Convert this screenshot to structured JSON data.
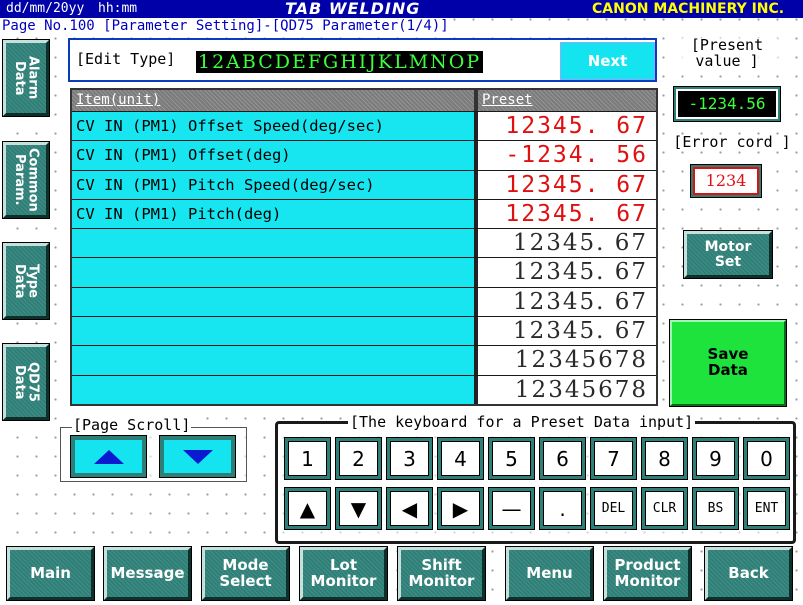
{
  "header": {
    "date": "dd/mm/20yy",
    "time": "hh:mm",
    "title": "TAB WELDING",
    "company": "CANON MACHINERY INC."
  },
  "page_line": "Page No.100 [Parameter Setting]-[QD75 Parameter(1/4)]",
  "side_tabs": [
    "Alarm Data",
    "Common Param.",
    "Type Data",
    "QD75 Data"
  ],
  "edit_type": {
    "label": "[Edit Type]",
    "value": "12ABCDEFGHIJKLMNOP",
    "next_label": "Next"
  },
  "table": {
    "headers": [
      "Item(unit)",
      "Preset"
    ],
    "rows": [
      {
        "item": "CV IN (PM1) Offset Speed(deg/sec)",
        "value": "12345. 67"
      },
      {
        "item": "CV IN (PM1) Offset(deg)",
        "value": "-1234. 56"
      },
      {
        "item": "CV IN (PM1) Pitch Speed(deg/sec)",
        "value": "12345. 67"
      },
      {
        "item": "CV IN (PM1) Pitch(deg)",
        "value": "12345. 67"
      },
      {
        "item": "",
        "value": "12345. 67"
      },
      {
        "item": "",
        "value": "12345. 67"
      },
      {
        "item": "",
        "value": "12345. 67"
      },
      {
        "item": "",
        "value": "12345. 67"
      },
      {
        "item": "",
        "value": "12345678"
      },
      {
        "item": "",
        "value": "12345678"
      }
    ]
  },
  "present_value": {
    "label": "[Present\nvalue ]",
    "value": "-1234.56"
  },
  "error_code": {
    "label": "[Error cord ]",
    "value": "1234"
  },
  "motor_set_label": "Motor\nSet",
  "save_label": "Save\nData",
  "page_scroll_label": "[Page Scroll]",
  "keyboard": {
    "title": "[The keyboard for a Preset Data input]",
    "row1": [
      "1",
      "2",
      "3",
      "4",
      "5",
      "6",
      "7",
      "8",
      "9",
      "0"
    ],
    "row2": [
      "▲",
      "▼",
      "◀",
      "▶",
      "—",
      ".",
      "DEL",
      "CLR",
      "BS",
      "ENT"
    ]
  },
  "bottom_nav": [
    "Main",
    "Message",
    "Mode\nSelect",
    "Lot\nMonitor",
    "Shift\nMonitor",
    "Menu",
    "Product\nMonitor",
    "Back"
  ],
  "colors": {
    "header_bg": "#0000a8",
    "button_green": "#2e7f77",
    "cyan": "#17e6f0",
    "save_green": "#1ee33c",
    "red_value": "#e01010"
  }
}
